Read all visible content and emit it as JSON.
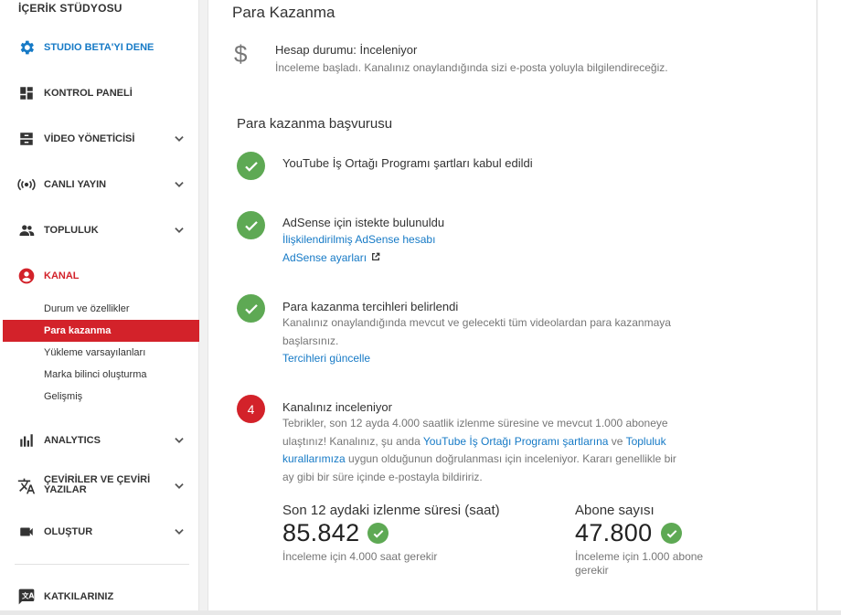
{
  "sidebar": {
    "title": "İÇERİK STÜDYOSU",
    "items": [
      {
        "label": "STUDIO BETA'YI DENE",
        "icon": "gear-icon",
        "color": "#167ac6"
      },
      {
        "label": "KONTROL PANELİ",
        "icon": "dashboard-icon"
      },
      {
        "label": "VİDEO YÖNETİCİSİ",
        "icon": "video-manager-icon",
        "expandable": true
      },
      {
        "label": "CANLI YAYIN",
        "icon": "live-broadcast-icon",
        "expandable": true
      },
      {
        "label": "TOPLULUK",
        "icon": "community-icon",
        "expandable": true
      },
      {
        "label": "KANAL",
        "icon": "channel-icon",
        "color": "#d3222a"
      },
      {
        "label": "ANALYTICS",
        "icon": "analytics-icon",
        "expandable": true
      },
      {
        "label_line1": "ÇEVİRİLER VE ÇEVİRİ",
        "label_line2": "YAZILAR",
        "icon": "translate-icon",
        "expandable": true
      },
      {
        "label": "OLUŞTUR",
        "icon": "create-icon",
        "expandable": true
      },
      {
        "label": "KATKILARINIZ",
        "icon": "contributions-icon"
      }
    ],
    "channel_sub": [
      "Durum ve özellikler",
      "Para kazanma",
      "Yükleme varsayılanları",
      "Marka bilinci oluşturma",
      "Gelişmiş"
    ],
    "active_sub": "Para kazanma"
  },
  "main": {
    "title": "Para Kazanma",
    "account_status": "Hesap durumu: İnceleniyor",
    "account_desc": "İnceleme başladı. Kanalınız onaylandığında sizi e-posta yoluyla bilgilendireceğiz.",
    "section_title": "Para kazanma başvurusu",
    "step1": {
      "title": "YouTube İş Ortağı Programı şartları kabul edildi"
    },
    "step2": {
      "title": "AdSense için istekte bulunuldu",
      "link1": "İlişkilendirilmiş AdSense hesabı",
      "link2": "AdSense ayarları"
    },
    "step3": {
      "title": "Para kazanma tercihleri belirlendi",
      "text_line1": "Kanalınız onaylandığında mevcut ve gelecekti tüm videolardan para kazanmaya",
      "text_line2": "başlarsınız.",
      "link": "Tercihleri güncelle"
    },
    "step4": {
      "number": "4",
      "title": "Kanalınız inceleniyor",
      "text_line1": "Tebrikler, son 12 ayda 4.000 saatlik izlenme süresine ve mevcut 1.000 aboneye",
      "text_line2_a": "ulaştınız! Kanalınız, şu anda ",
      "text_line2_link1": "YouTube İş Ortağı Programı şartlarına",
      "text_line2_b": " ve ",
      "text_line2_link2": "Topluluk",
      "text_line3_link": "kurallarımıza",
      "text_line3_b": " uygun olduğunun doğrulanması için inceleniyor. Kararı genellikle bir",
      "text_line4": "ay gibi bir süre içinde e-postayla bildiririz."
    },
    "stats": [
      {
        "label": "Son 12 aydaki izlenme süresi (saat)",
        "value": "85.842",
        "note_line1": "İnceleme için 4.000 saat gerekir",
        "note_line2": ""
      },
      {
        "label": "Abone sayısı",
        "value": "47.800",
        "note_line1": "İnceleme için 1.000 abone",
        "note_line2": "gerekir"
      }
    ]
  },
  "colors": {
    "accent_red": "#d3222a",
    "link_blue": "#167ac6",
    "success_green": "#5ea954"
  }
}
